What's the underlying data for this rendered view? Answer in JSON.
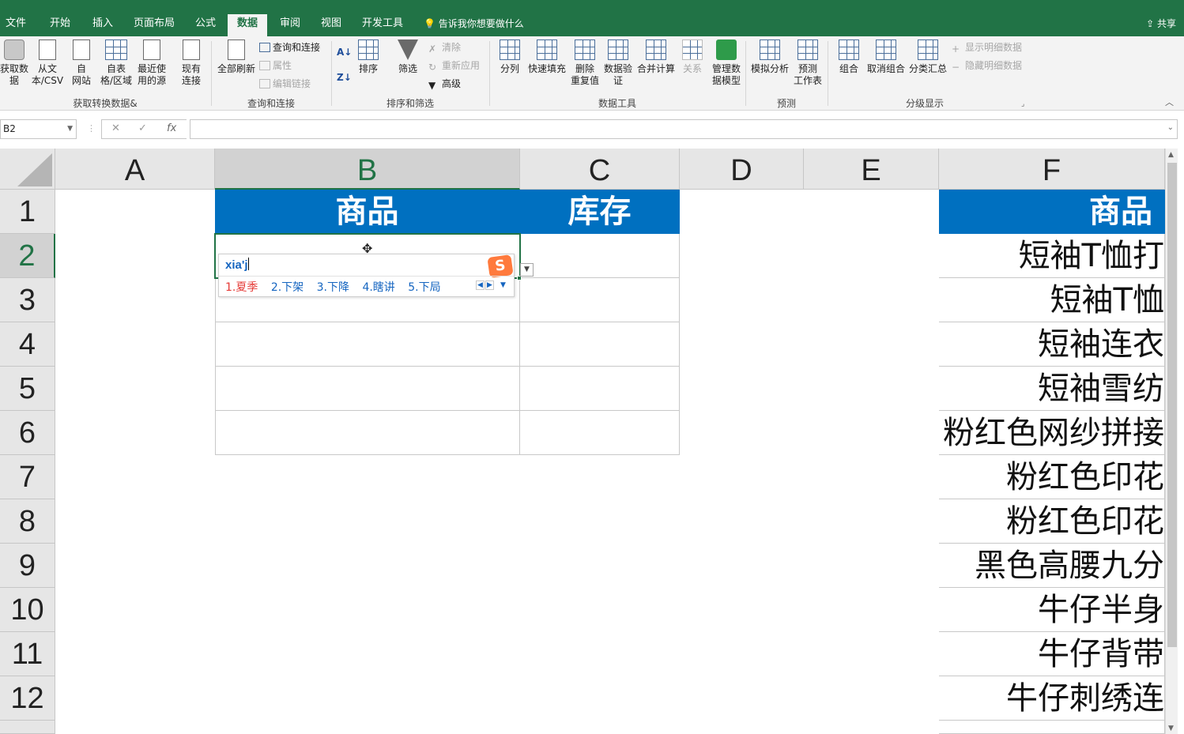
{
  "tabs": [
    "文件",
    "开始",
    "插入",
    "页面布局",
    "公式",
    "数据",
    "审阅",
    "视图",
    "开发工具"
  ],
  "active_tab": "数据",
  "tell_me": "告诉我你想要做什么",
  "share": "共享",
  "ribbon": {
    "get_transform": {
      "buttons": [
        "获取数\n据",
        "从文\n本/CSV",
        "自\n网站",
        "自表\n格/区域",
        "最近使\n用的源",
        "现有\n连接"
      ],
      "label": "获取转换数据&"
    },
    "queries": {
      "refresh_all": "全部刷新",
      "small": [
        "查询和连接",
        "属性",
        "编辑链接"
      ],
      "label": "查询和连接"
    },
    "sort_filter": {
      "sort": "排序",
      "filter": "筛选",
      "small": [
        "清除",
        "重新应用",
        "高级"
      ],
      "label": "排序和筛选"
    },
    "data_tools": {
      "buttons": [
        "分列",
        "快速填充",
        "删除\n重复值",
        "数据验\n证",
        "合并计算",
        "关系",
        "管理数\n据模型"
      ],
      "label": "数据工具"
    },
    "forecast": {
      "buttons": [
        "模拟分析",
        "预测\n工作表"
      ],
      "label": "预测"
    },
    "outline": {
      "buttons": [
        "组合",
        "取消组合",
        "分类汇总"
      ],
      "small": [
        "显示明细数据",
        "隐藏明细数据"
      ],
      "label": "分级显示"
    }
  },
  "name_box": "B2",
  "formula_value": "",
  "columns": [
    "A",
    "B",
    "C",
    "D",
    "E",
    "F"
  ],
  "rows": [
    "1",
    "2",
    "3",
    "4",
    "5",
    "6",
    "7",
    "8",
    "9",
    "10",
    "11",
    "12"
  ],
  "table1": {
    "header_b": "商品",
    "header_c": "库存"
  },
  "table2": {
    "header": "商品",
    "items": [
      "短袖T恤打",
      "短袖T恤",
      "短袖连衣",
      "短袖雪纺",
      "粉红色网纱拼接",
      "粉红色印花",
      "粉红色印花",
      "黑色高腰九分",
      "牛仔半身",
      "牛仔背带",
      "牛仔刺绣连"
    ]
  },
  "ime": {
    "composition": "xia'j",
    "candidates": [
      "1.夏季",
      "2.下架",
      "3.下降",
      "4.瞎讲",
      "5.下局"
    ],
    "logo": "S"
  },
  "colors": {
    "excel_green": "#217346",
    "header_blue": "#0070c0"
  }
}
